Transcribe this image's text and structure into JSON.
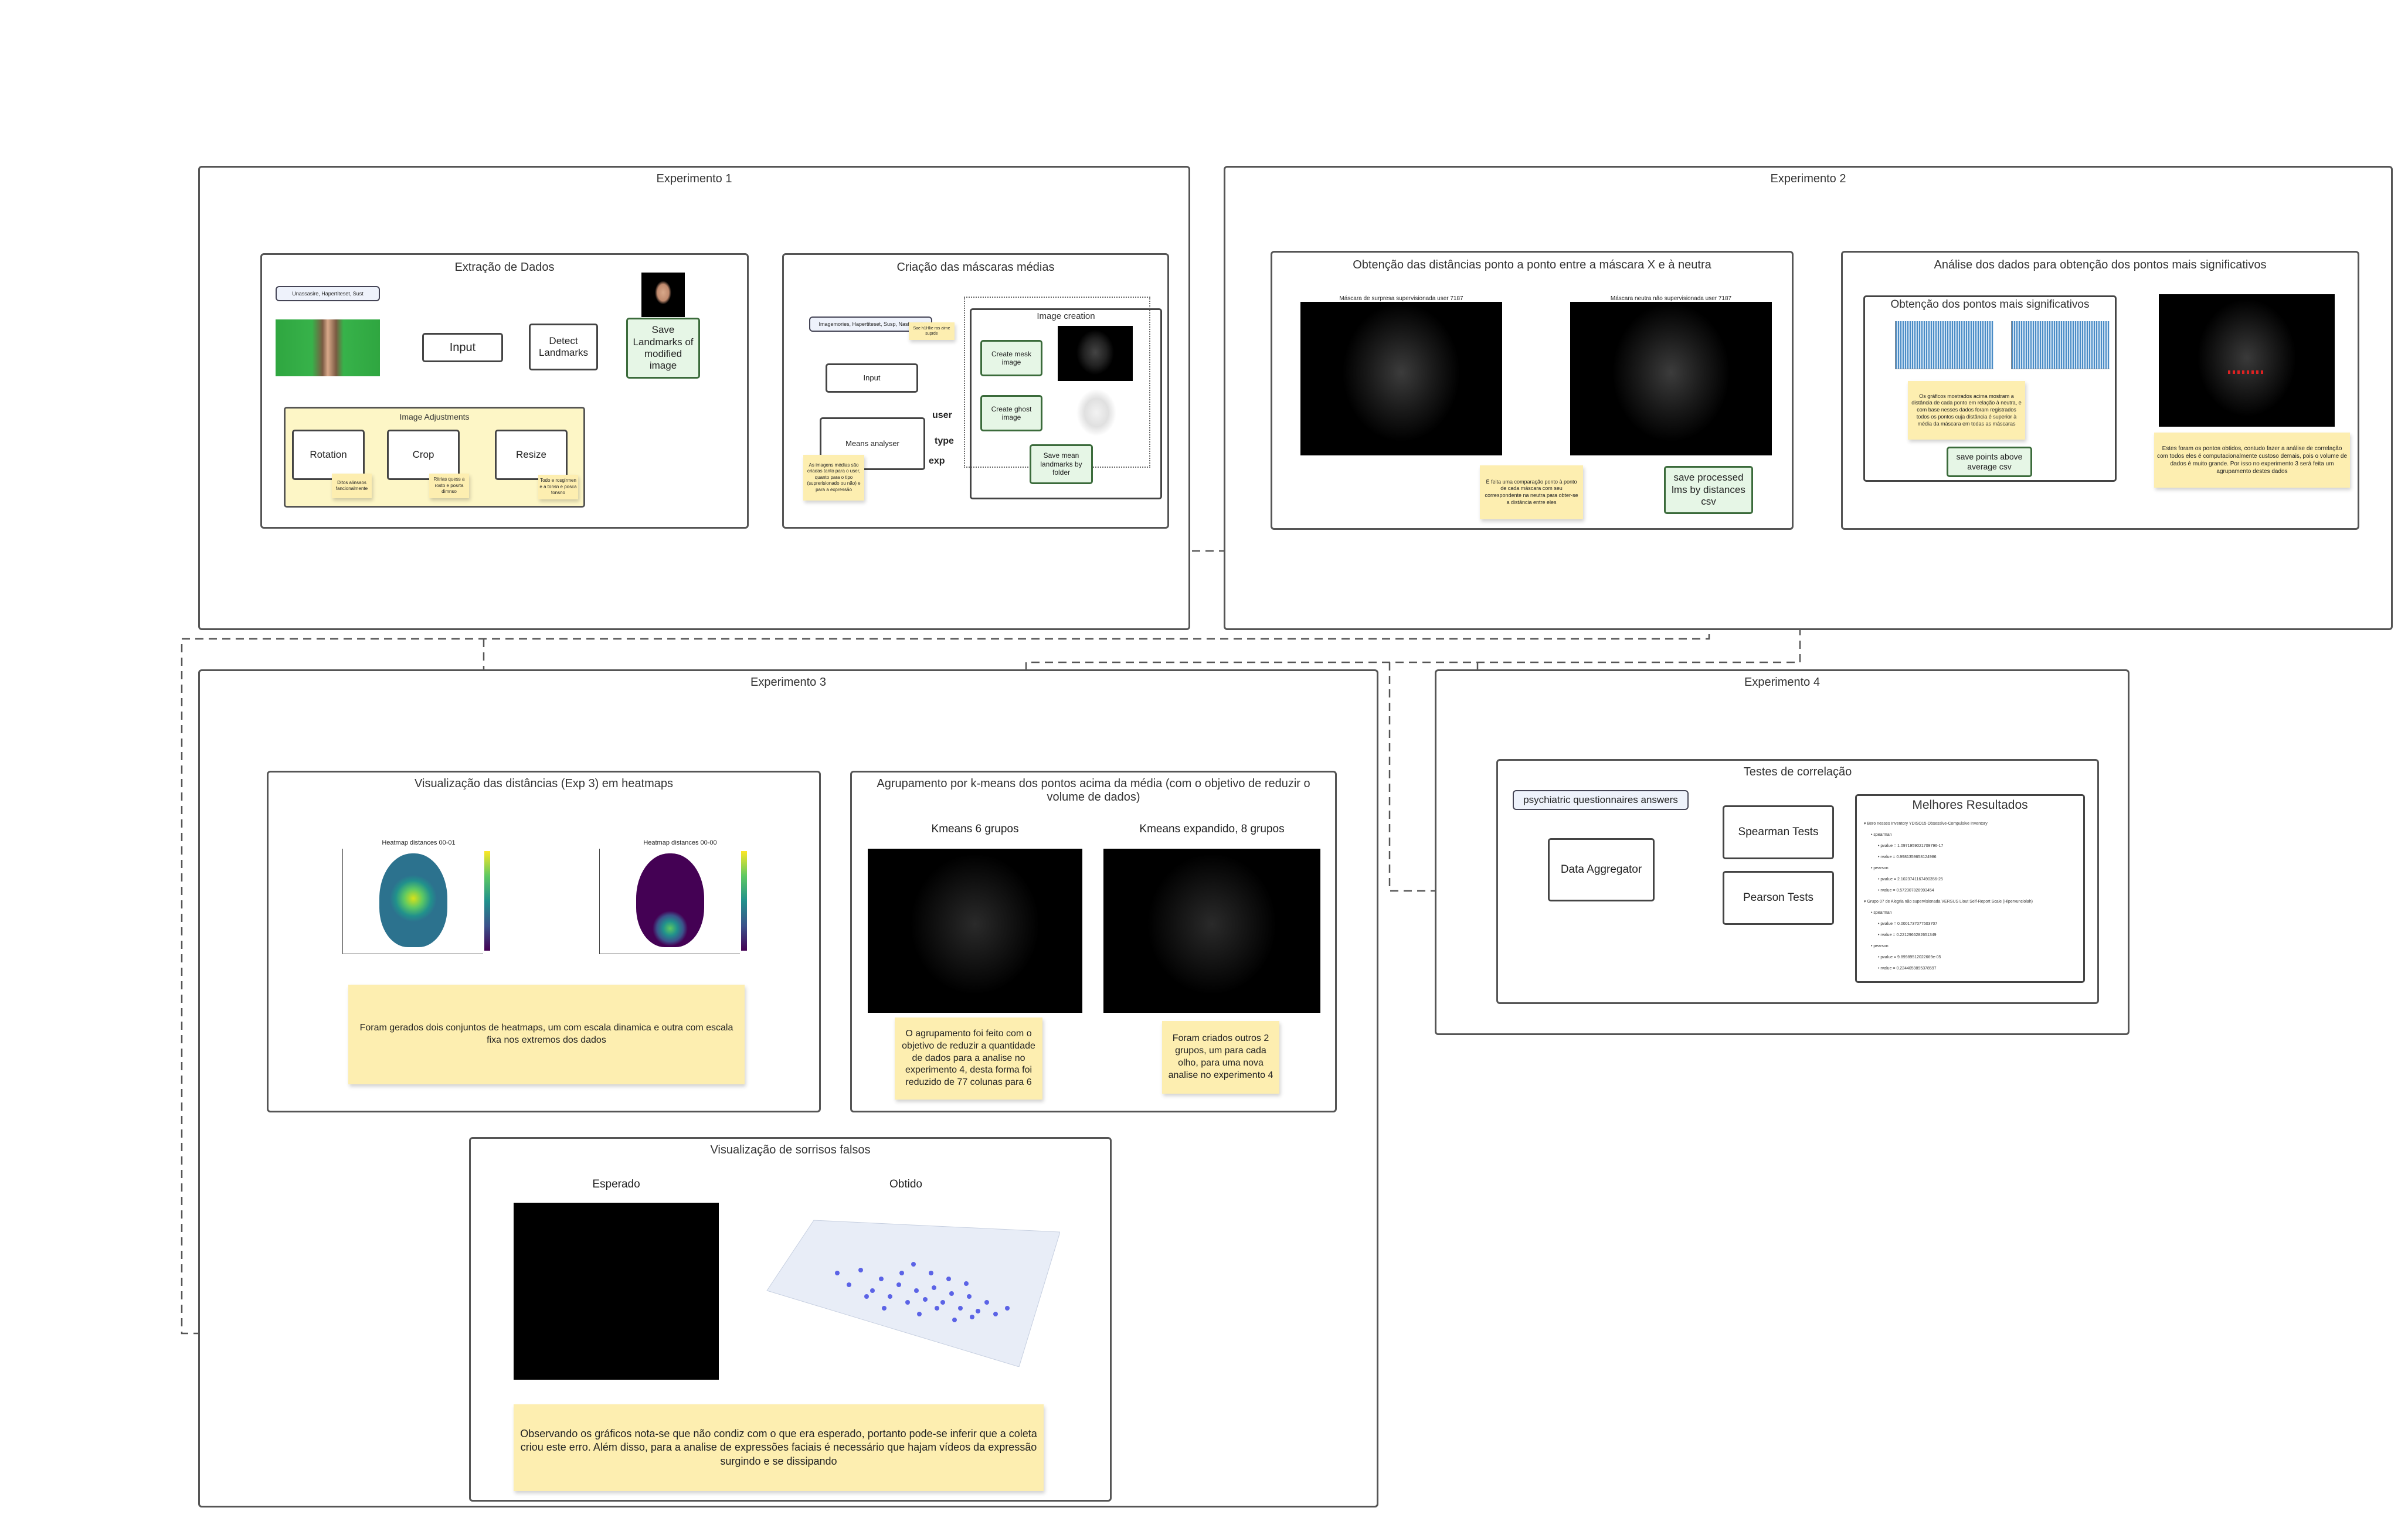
{
  "exp1": {
    "title": "Experimento 1",
    "extracao": {
      "title": "Extração de Dados",
      "tag": "Unassasire, Hapertiteset, Sust",
      "input": "Input",
      "detect": "Detect Landmarks",
      "save": "Save Landmarks of modified image",
      "adjustments": {
        "title": "Image Adjustments",
        "rotation": "Rotation",
        "crop": "Crop",
        "resize": "Resize",
        "note_rotation": "Ditos alinsaos fancionalmente",
        "note_crop": "Ritrias quess a rosto e posrta dimnso",
        "note_resize": "Todo e rosgirmen e a tonsn e posca tonsno"
      }
    },
    "mascaras": {
      "title": "Criação das máscaras médias",
      "tag": "Imagemories, Hapertiteset, Susp, Nasfvarnd",
      "tag_note": "Sae h1Hlie ras aime suprde",
      "input": "Input",
      "means": "Means analyser",
      "user": "user",
      "type": "type",
      "exp": "exp",
      "note": "As imagens médias são criadas tanto para o user, quanto para o tipo (suprerisionado ou não) e para a expressão",
      "creation": {
        "title": "Image creation",
        "create_mask": "Create mesk image",
        "create_ghost": "Create ghost image",
        "save_mean": "Save mean landmarks by folder"
      }
    }
  },
  "exp2": {
    "title": "Experimento 2",
    "distancias": {
      "title": "Obtenção das distâncias ponto a ponto entre a máscara X e à neutra",
      "cap_left": "Máscara de surpresa supervisionada user 7187",
      "cap_right": "Máscara neutra não supervisionada user 7187",
      "note": "É feita uma comparação ponto à ponto de cada máscara com seu correspondente na neutra para obter-se a distância entre eles",
      "save": "save processed lms by distances csv"
    },
    "analise": {
      "title": "Análise dos dados para obtenção dos pontos mais significativos",
      "sub_title": "Obtenção dos pontos mais significativos",
      "note": "Os gráficos mostrados acima mostram a distância de cada ponto em relação à neutra, e com base nesses dados foram registrados todos os pontos cuja distância é superior à média da máscara em todas as máscaras",
      "save": "save points above average csv",
      "note_right": "Estes foram os pontos obtidos, contudo fazer a análise de correlação com todos eles é computacionalmente custoso demais, pois o volume de dados é muito grande. Por isso no experimento 3 será feita um agrupamento destes dados"
    }
  },
  "exp3": {
    "title": "Experimento 3",
    "heatmaps": {
      "title": "Visualização das distâncias (Exp 3) em heatmaps",
      "hm1_title": "Heatmap distances 00-01",
      "hm2_title": "Heatmap distances 00-00",
      "note": "Foram gerados dois conjuntos de heatmaps, um com escala dinamica e outra com escala fixa nos extremos dos dados"
    },
    "kmeans": {
      "title": "Agrupamento por k-means dos pontos acima da média (com o objetivo de reduzir o volume de dados)",
      "left_label": "Kmeans 6 grupos",
      "right_label": "Kmeans expandido, 8 grupos",
      "note_left": "O agrupamento foi feito com o objetivo de reduzir a quantidade de dados para a analise no experimento 4, desta forma foi reduzido de 77 colunas para 6",
      "note_right": "Foram criados outros 2 grupos, um para cada olho, para uma nova analise no experimento 4"
    },
    "sorrisos": {
      "title": "Visualização de sorrisos falsos",
      "esperado": "Esperado",
      "obtido": "Obtido",
      "note": "Observando os gráficos nota-se que não condiz com o que era esperado, portanto pode-se inferir que a coleta criou este erro. Além disso, para a analise de expressões faciais é necessário que hajam vídeos da expressão surgindo e se dissipando"
    }
  },
  "exp4": {
    "title": "Experimento 4",
    "testes": {
      "title": "Testes de correlação",
      "psy": "psychiatric questionnaires answers",
      "aggregator": "Data Aggregator",
      "spearman": "Spearman Tests",
      "pearson": "Pearson Tests",
      "best": {
        "title": "Melhores Resultados",
        "lines": [
          "▾ Bero nesses Inventory YDISO15 Obsessive-Compulsive Inventory",
          "• spearman",
          "• pvalue = 1.0971959021709796-17",
          "• rvalue = 0.9981359658124986",
          "• pearson",
          "• pvalue = 2.1023741167490356-25",
          "• rvalue = 0.572307828993454",
          "▾ Grupo 07 de Alegria não supervisionada VERSUS Liout Self-Report Scale (Hipervunciolah)",
          "• spearman",
          "• pvalue = 0.0001737077503707",
          "• rvalue = 0.2212966282651349",
          "• pearson",
          "• pvalue = 9.89989512022669e-05",
          "• rvalue = 0.2244059895378597"
        ]
      }
    }
  },
  "colors": {
    "note": "#fdeeb0",
    "green_box": "#e6f6e6",
    "frame_border": "#555555"
  }
}
